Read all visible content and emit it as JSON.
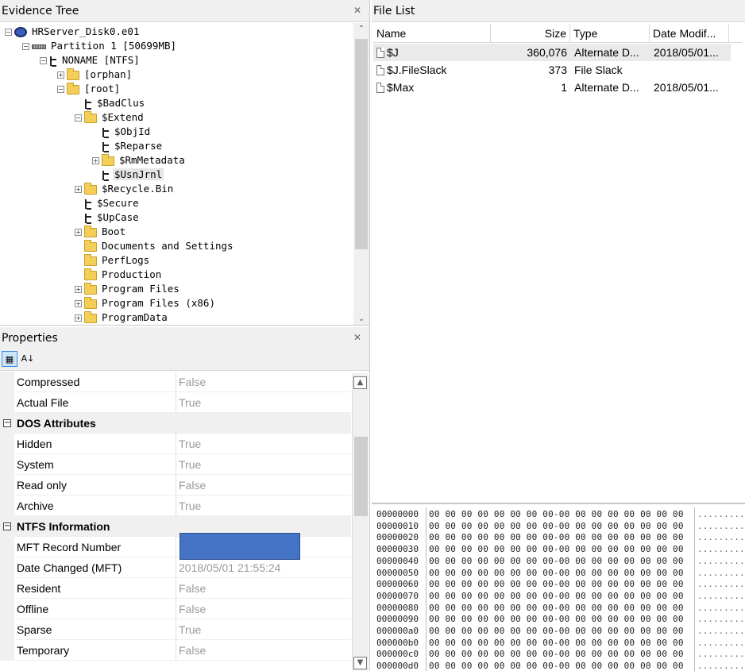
{
  "evidence_tree": {
    "title": "Evidence Tree",
    "items": [
      {
        "label": "HRServer_Disk0.e01",
        "depth": 0,
        "icon": "disk-icon",
        "expander": "-"
      },
      {
        "label": "Partition 1 [50699MB]",
        "depth": 1,
        "icon": "partition-icon",
        "expander": "-"
      },
      {
        "label": "NONAME [NTFS]",
        "depth": 2,
        "icon": "filesystem-icon",
        "expander": "-"
      },
      {
        "label": "[orphan]",
        "depth": 3,
        "icon": "folder-icon",
        "expander": "+"
      },
      {
        "label": "[root]",
        "depth": 3,
        "icon": "folder-icon",
        "expander": "-"
      },
      {
        "label": "$BadClus",
        "depth": 4,
        "icon": "filesystem-icon",
        "expander": ""
      },
      {
        "label": "$Extend",
        "depth": 4,
        "icon": "folder-icon",
        "expander": "-"
      },
      {
        "label": "$ObjId",
        "depth": 5,
        "icon": "filesystem-icon",
        "expander": ""
      },
      {
        "label": "$Reparse",
        "depth": 5,
        "icon": "filesystem-icon",
        "expander": ""
      },
      {
        "label": "$RmMetadata",
        "depth": 5,
        "icon": "folder-icon",
        "expander": "+"
      },
      {
        "label": "$UsnJrnl",
        "depth": 5,
        "icon": "filesystem-icon",
        "expander": "",
        "selected": true
      },
      {
        "label": "$Recycle.Bin",
        "depth": 4,
        "icon": "folder-icon",
        "expander": "+"
      },
      {
        "label": "$Secure",
        "depth": 4,
        "icon": "filesystem-icon",
        "expander": ""
      },
      {
        "label": "$UpCase",
        "depth": 4,
        "icon": "filesystem-icon",
        "expander": ""
      },
      {
        "label": "Boot",
        "depth": 4,
        "icon": "folder-icon",
        "expander": "+"
      },
      {
        "label": "Documents and Settings",
        "depth": 4,
        "icon": "folder-icon",
        "expander": ""
      },
      {
        "label": "PerfLogs",
        "depth": 4,
        "icon": "folder-icon",
        "expander": ""
      },
      {
        "label": "Production",
        "depth": 4,
        "icon": "folder-icon",
        "expander": ""
      },
      {
        "label": "Program Files",
        "depth": 4,
        "icon": "folder-icon",
        "expander": "+"
      },
      {
        "label": "Program Files (x86)",
        "depth": 4,
        "icon": "folder-icon",
        "expander": "+"
      },
      {
        "label": "ProgramData",
        "depth": 4,
        "icon": "folder-icon",
        "expander": "+"
      }
    ]
  },
  "properties": {
    "title": "Properties",
    "rows": [
      {
        "type": "prop",
        "name": "Compressed",
        "value": "False"
      },
      {
        "type": "prop",
        "name": "Actual File",
        "value": "True"
      },
      {
        "type": "cat",
        "name": "DOS Attributes"
      },
      {
        "type": "prop",
        "name": "Hidden",
        "value": "True"
      },
      {
        "type": "prop",
        "name": "System",
        "value": "True"
      },
      {
        "type": "prop",
        "name": "Read only",
        "value": "False"
      },
      {
        "type": "prop",
        "name": "Archive",
        "value": "True"
      },
      {
        "type": "cat",
        "name": "NTFS Information"
      },
      {
        "type": "prop",
        "name": "MFT Record Number",
        "value": "",
        "redacted": true
      },
      {
        "type": "prop",
        "name": "Date Changed (MFT)",
        "value": "2018/05/01 21:55:24"
      },
      {
        "type": "prop",
        "name": "Resident",
        "value": "False"
      },
      {
        "type": "prop",
        "name": "Offline",
        "value": "False"
      },
      {
        "type": "prop",
        "name": "Sparse",
        "value": "True"
      },
      {
        "type": "prop",
        "name": "Temporary",
        "value": "False"
      }
    ]
  },
  "file_list": {
    "title": "File List",
    "columns": [
      "Name",
      "Size",
      "Type",
      "Date Modif..."
    ],
    "rows": [
      {
        "name": "$J",
        "size": "360,076",
        "type": "Alternate D...",
        "date": "2018/05/01...",
        "selected": true
      },
      {
        "name": "$J.FileSlack",
        "size": "373",
        "type": "File Slack",
        "date": ""
      },
      {
        "name": "$Max",
        "size": "1",
        "type": "Alternate D...",
        "date": "2018/05/01..."
      }
    ]
  },
  "hex_view": {
    "rows": [
      {
        "offset": "00000000",
        "bytes": "00 00 00 00 00 00 00 00-00 00 00 00 00 00 00 00",
        "ascii": "................"
      },
      {
        "offset": "00000010",
        "bytes": "00 00 00 00 00 00 00 00-00 00 00 00 00 00 00 00",
        "ascii": "................"
      },
      {
        "offset": "00000020",
        "bytes": "00 00 00 00 00 00 00 00-00 00 00 00 00 00 00 00",
        "ascii": "................"
      },
      {
        "offset": "00000030",
        "bytes": "00 00 00 00 00 00 00 00-00 00 00 00 00 00 00 00",
        "ascii": "................"
      },
      {
        "offset": "00000040",
        "bytes": "00 00 00 00 00 00 00 00-00 00 00 00 00 00 00 00",
        "ascii": "................"
      },
      {
        "offset": "00000050",
        "bytes": "00 00 00 00 00 00 00 00-00 00 00 00 00 00 00 00",
        "ascii": "................"
      },
      {
        "offset": "00000060",
        "bytes": "00 00 00 00 00 00 00 00-00 00 00 00 00 00 00 00",
        "ascii": "................"
      },
      {
        "offset": "00000070",
        "bytes": "00 00 00 00 00 00 00 00-00 00 00 00 00 00 00 00",
        "ascii": "................"
      },
      {
        "offset": "00000080",
        "bytes": "00 00 00 00 00 00 00 00-00 00 00 00 00 00 00 00",
        "ascii": "................"
      },
      {
        "offset": "00000090",
        "bytes": "00 00 00 00 00 00 00 00-00 00 00 00 00 00 00 00",
        "ascii": "................"
      },
      {
        "offset": "000000a0",
        "bytes": "00 00 00 00 00 00 00 00-00 00 00 00 00 00 00 00",
        "ascii": "................"
      },
      {
        "offset": "000000b0",
        "bytes": "00 00 00 00 00 00 00 00-00 00 00 00 00 00 00 00",
        "ascii": "................"
      },
      {
        "offset": "000000c0",
        "bytes": "00 00 00 00 00 00 00 00-00 00 00 00 00 00 00 00",
        "ascii": "................"
      },
      {
        "offset": "000000d0",
        "bytes": "00 00 00 00 00 00 00 00-00 00 00 00 00 00 00 00",
        "ascii": "................"
      }
    ]
  },
  "colors": {
    "redaction": "#4472c4",
    "folder": "#f3cf5a",
    "pane_header": "#f0f0f0"
  }
}
